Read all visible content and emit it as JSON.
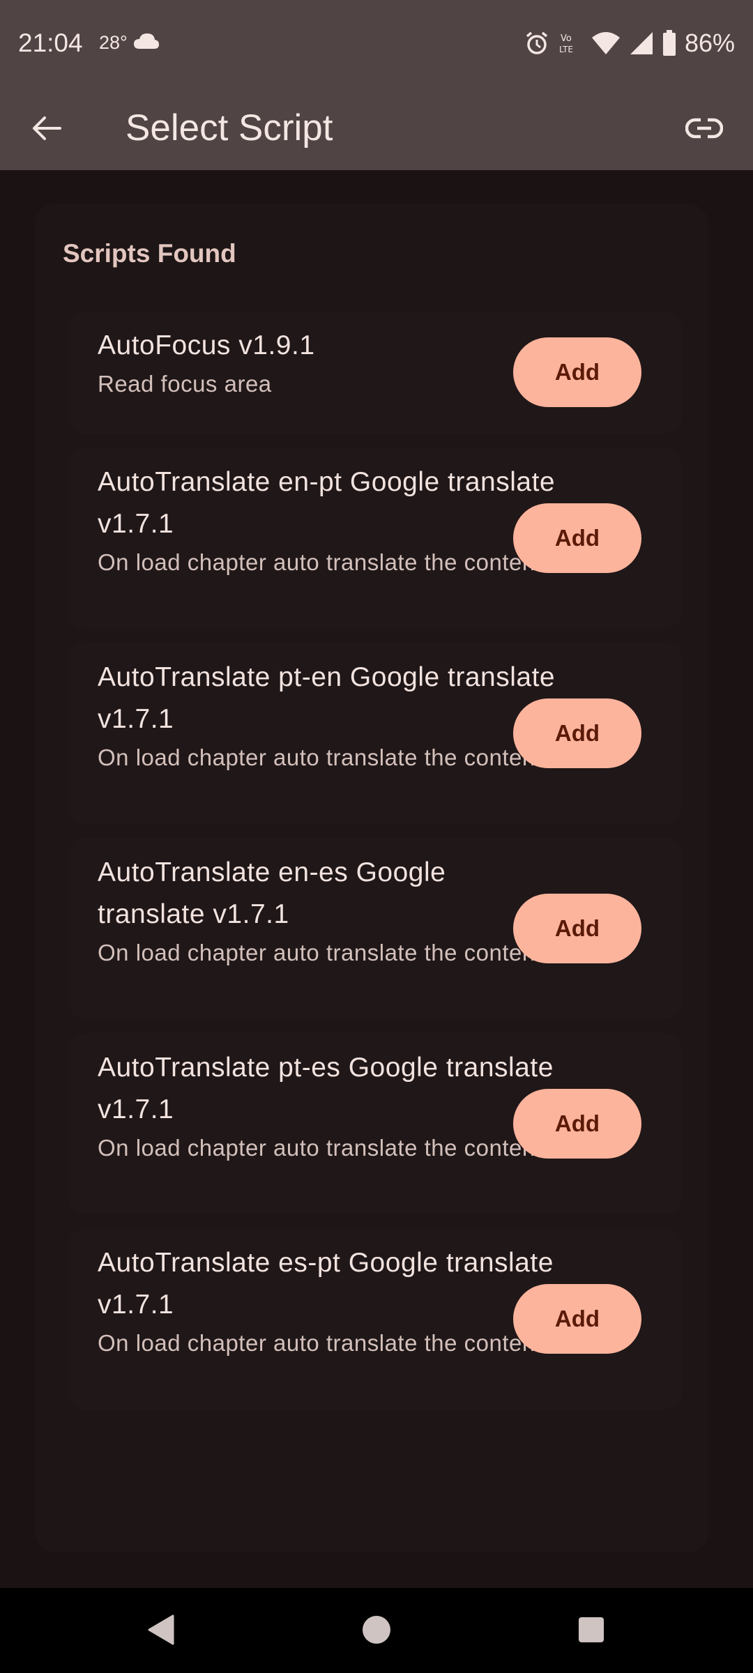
{
  "status_bar": {
    "time": "21:04",
    "temperature": "28°",
    "battery": "86%",
    "icons": [
      "cloud-icon",
      "alarm-icon",
      "volte-icon",
      "wifi-icon",
      "signal-icon",
      "battery-icon"
    ]
  },
  "app_bar": {
    "title": "Select Script",
    "back_icon": "arrow-back-icon",
    "link_icon": "link-icon",
    "background": "#514444"
  },
  "content": {
    "heading": "Scripts Found",
    "add_button_color": "#fdb49c",
    "scripts": [
      {
        "name": "AutoFocus v1.9.1",
        "description": "Read focus area",
        "button": "Add"
      },
      {
        "name": "AutoTranslate en-pt Google translate v1.7.1",
        "description": "On load chapter auto translate the content",
        "button": "Add"
      },
      {
        "name": "AutoTranslate pt-en Google translate v1.7.1",
        "description": "On load chapter auto translate the content",
        "button": "Add"
      },
      {
        "name": "AutoTranslate en-es Google translate v1.7.1",
        "description": "On load chapter auto translate the content",
        "button": "Add"
      },
      {
        "name": "AutoTranslate pt-es Google translate v1.7.1",
        "description": "On load chapter auto translate the content",
        "button": "Add"
      },
      {
        "name": "AutoTranslate es-pt Google translate v1.7.1",
        "description": "On load chapter auto translate the content",
        "button": "Add"
      }
    ]
  },
  "nav_bar": {
    "icons": [
      "nav-back-icon",
      "nav-home-icon",
      "nav-recents-icon"
    ]
  }
}
